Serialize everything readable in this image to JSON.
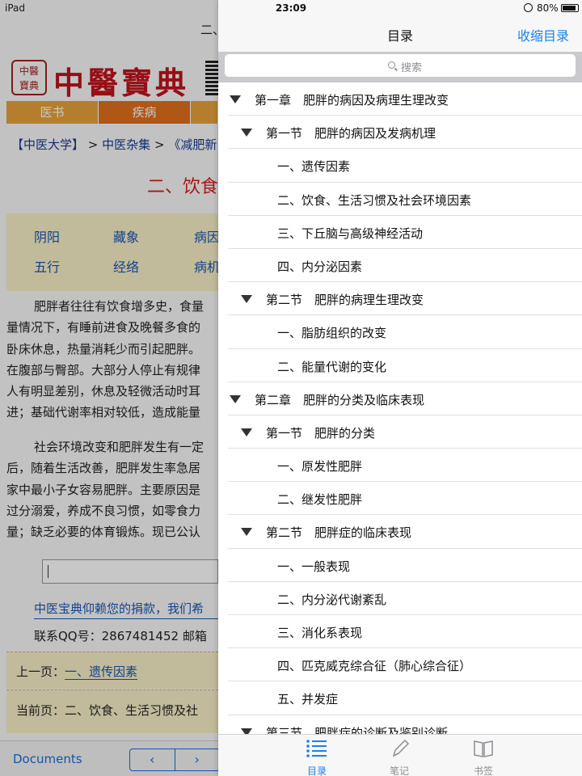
{
  "status": {
    "device": "iPad",
    "time": "23:09",
    "battery": "80%"
  },
  "background_page": {
    "title_fragment": "二、",
    "logo_seal_lines": [
      "中醫",
      "寶典"
    ],
    "logo_text": "中醫寶典",
    "nav_items": [
      "医书",
      "疾病"
    ],
    "breadcrumb": {
      "item1": "【中医大学】",
      "sep1": ">",
      "item2": "中医杂集",
      "sep2": ">",
      "item3": "《减肥新"
    },
    "heading": "二、饮食",
    "topics": [
      "阴阳",
      "藏象",
      "病因",
      "五行",
      "经络",
      "病机"
    ],
    "paragraph1": [
      "肥胖者往往有饮食增多史，食量",
      "量情况下，有睡前进食及晚餐多食的",
      "卧床休息，热量消耗少而引起肥胖。",
      "在腹部与臀部。大部分人停止有规律",
      "人有明显差别，休息及轻微活动时耳",
      "进；基础代谢率相对较低，造成能量"
    ],
    "paragraph2": [
      "社会环境改变和肥胖发生有一定",
      "后，随着生活改善，肥胖发生率急居",
      "家中最小子女容易肥胖。主要原因是",
      "过分溺爱，养成不良习惯，如零食力",
      "量；缺乏必要的体育锻炼。现已公认"
    ],
    "donate": "中医宝典仰赖您的捐款，我们希",
    "contact": "联系QQ号：2867481452  邮箱",
    "prev_label": "上一页：",
    "prev_link": "一、遗传因素",
    "current": "当前页：二、饮食、生活习惯及社",
    "toolbar": {
      "documents": "Documents",
      "back": "‹",
      "forward": "›"
    }
  },
  "panel": {
    "title": "目录",
    "collapse": "收缩目录",
    "search_placeholder": "搜索",
    "toc": [
      {
        "level": 0,
        "label": "第一章　肥胖的病因及病理生理改变",
        "expanded": true
      },
      {
        "level": 1,
        "label": "第一节　肥胖的病因及发病机理",
        "expanded": true
      },
      {
        "level": 2,
        "label": "一、遗传因素"
      },
      {
        "level": 2,
        "label": "二、饮食、生活习惯及社会环境因素"
      },
      {
        "level": 2,
        "label": "三、下丘脑与高级神经活动"
      },
      {
        "level": 2,
        "label": "四、内分泌因素"
      },
      {
        "level": 1,
        "label": "第二节　肥胖的病理生理改变",
        "expanded": true
      },
      {
        "level": 2,
        "label": "一、脂肪组织的改变"
      },
      {
        "level": 2,
        "label": "二、能量代谢的变化"
      },
      {
        "level": 0,
        "label": "第二章　肥胖的分类及临床表现",
        "expanded": true
      },
      {
        "level": 1,
        "label": "第一节　肥胖的分类",
        "expanded": true
      },
      {
        "level": 2,
        "label": "一、原发性肥胖"
      },
      {
        "level": 2,
        "label": "二、继发性肥胖"
      },
      {
        "level": 1,
        "label": "第二节　肥胖症的临床表现",
        "expanded": true
      },
      {
        "level": 2,
        "label": "一、一般表现"
      },
      {
        "level": 2,
        "label": "二、内分泌代谢紊乱"
      },
      {
        "level": 2,
        "label": "三、消化系表现"
      },
      {
        "level": 2,
        "label": "四、匹克威克综合征（肺心综合征）"
      },
      {
        "level": 2,
        "label": "五、并发症"
      },
      {
        "level": 1,
        "label": "第三节　肥胖症的诊断及鉴别诊断",
        "expanded": true
      }
    ],
    "tabs": [
      {
        "label": "目录",
        "icon": "list-icon",
        "active": true
      },
      {
        "label": "笔记",
        "icon": "pencil-icon",
        "active": false
      },
      {
        "label": "书签",
        "icon": "book-icon",
        "active": false
      }
    ]
  },
  "colors": {
    "accent": "#1a82e8",
    "brand_red": "#c0141c",
    "link_blue": "#1a55b0",
    "nav_orange": "#e0701c"
  }
}
